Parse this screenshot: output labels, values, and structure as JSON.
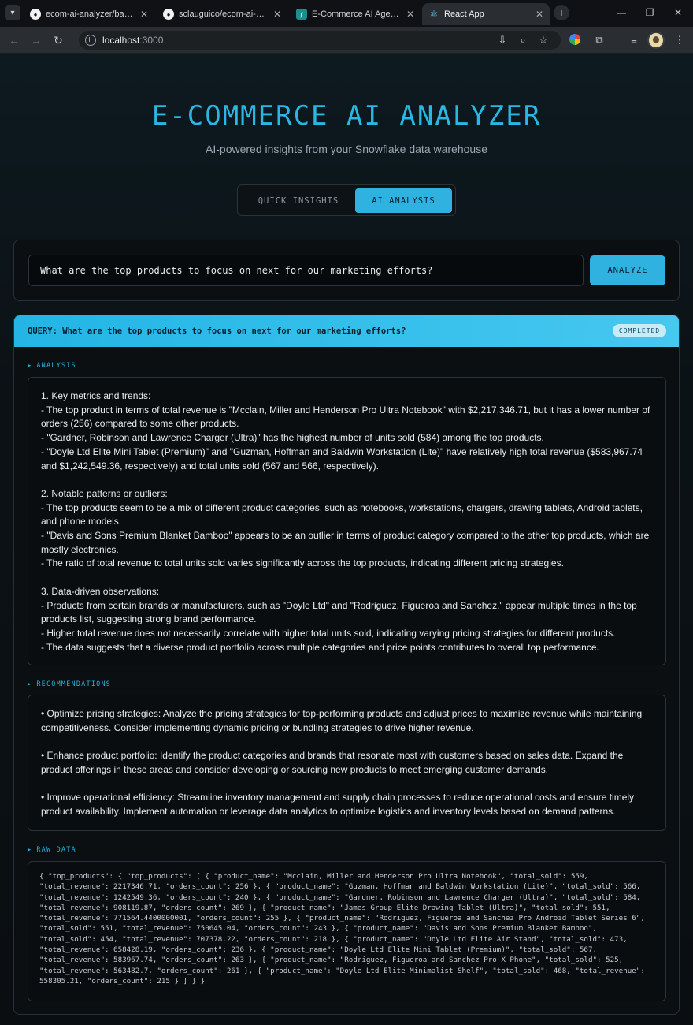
{
  "browser": {
    "tabs": [
      {
        "title": "ecom-ai-analyzer/backend",
        "icon": "github-icon"
      },
      {
        "title": "sclauguico/ecom-ai-analy",
        "icon": "github-icon"
      },
      {
        "title": "E-Commerce AI Agents A",
        "icon": "app-icon"
      },
      {
        "title": "React App",
        "icon": "react-icon",
        "active": true
      }
    ],
    "address": {
      "host": "localhost",
      "port": ":3000"
    }
  },
  "hero": {
    "title": "E-COMMERCE AI ANALYZER",
    "subtitle": "AI-powered insights from your Snowflake data warehouse"
  },
  "modes": {
    "quick_label": "QUICK INSIGHTS",
    "ai_label": "AI ANALYSIS",
    "active": "ai"
  },
  "query": {
    "value": "What are the top products to focus on next for our marketing efforts?",
    "analyze_label": "ANALYZE"
  },
  "result": {
    "header_text": "QUERY: What are the top products to focus on next for our marketing efforts?",
    "status": "COMPLETED",
    "analysis_label": "ANALYSIS",
    "analysis": {
      "s1_title": "1. Key metrics and trends:",
      "s1_l1": "- The top product in terms of total revenue is \"Mcclain, Miller and Henderson Pro Ultra Notebook\" with $2,217,346.71, but it has a lower number of orders (256) compared to some other products.",
      "s1_l2": "- \"Gardner, Robinson and Lawrence Charger (Ultra)\" has the highest number of units sold (584) among the top products.",
      "s1_l3": "- \"Doyle Ltd Elite Mini Tablet (Premium)\" and \"Guzman, Hoffman and Baldwin Workstation (Lite)\" have relatively high total revenue ($583,967.74 and $1,242,549.36, respectively) and total units sold (567 and 566, respectively).",
      "s2_title": "2. Notable patterns or outliers:",
      "s2_l1": "- The top products seem to be a mix of different product categories, such as notebooks, workstations, chargers, drawing tablets, Android tablets, and phone models.",
      "s2_l2": "- \"Davis and Sons Premium Blanket Bamboo\" appears to be an outlier in terms of product category compared to the other top products, which are mostly electronics.",
      "s2_l3": "- The ratio of total revenue to total units sold varies significantly across the top products, indicating different pricing strategies.",
      "s3_title": "3. Data-driven observations:",
      "s3_l1": "- Products from certain brands or manufacturers, such as \"Doyle Ltd\" and \"Rodriguez, Figueroa and Sanchez,\" appear multiple times in the top products list, suggesting strong brand performance.",
      "s3_l2": "- Higher total revenue does not necessarily correlate with higher total units sold, indicating varying pricing strategies for different products.",
      "s3_l3": "- The data suggests that a diverse product portfolio across multiple categories and price points contributes to overall top performance."
    },
    "recommendations_label": "RECOMMENDATIONS",
    "recommendations": {
      "r1": "• Optimize pricing strategies: Analyze the pricing strategies for top-performing products and adjust prices to maximize revenue while maintaining competitiveness. Consider implementing dynamic pricing or bundling strategies to drive higher revenue.",
      "r2": "• Enhance product portfolio: Identify the product categories and brands that resonate most with customers based on sales data. Expand the product offerings in these areas and consider developing or sourcing new products to meet emerging customer demands.",
      "r3": "• Improve operational efficiency: Streamline inventory management and supply chain processes to reduce operational costs and ensure timely product availability. Implement automation or leverage data analytics to optimize logistics and inventory levels based on demand patterns."
    },
    "raw_label": "RAW DATA",
    "raw_text": "{ \"top_products\": { \"top_products\": [ { \"product_name\": \"Mcclain, Miller and Henderson Pro Ultra Notebook\", \"total_sold\": 559, \"total_revenue\": 2217346.71, \"orders_count\": 256 }, { \"product_name\": \"Guzman, Hoffman and Baldwin Workstation (Lite)\", \"total_sold\": 566, \"total_revenue\": 1242549.36, \"orders_count\": 240 }, { \"product_name\": \"Gardner, Robinson and Lawrence Charger (Ultra)\", \"total_sold\": 584, \"total_revenue\": 908119.87, \"orders_count\": 269 }, { \"product_name\": \"James Group Elite Drawing Tablet (Ultra)\", \"total_sold\": 551, \"total_revenue\": 771564.4400000001, \"orders_count\": 255 }, { \"product_name\": \"Rodriguez, Figueroa and Sanchez Pro Android Tablet Series 6\", \"total_sold\": 551, \"total_revenue\": 750645.04, \"orders_count\": 243 }, { \"product_name\": \"Davis and Sons Premium Blanket Bamboo\", \"total_sold\": 454, \"total_revenue\": 707378.22, \"orders_count\": 218 }, { \"product_name\": \"Doyle Ltd Elite Air Stand\", \"total_sold\": 473, \"total_revenue\": 658428.19, \"orders_count\": 236 }, { \"product_name\": \"Doyle Ltd Elite Mini Tablet (Premium)\", \"total_sold\": 567, \"total_revenue\": 583967.74, \"orders_count\": 263 }, { \"product_name\": \"Rodriguez, Figueroa and Sanchez Pro X Phone\", \"total_sold\": 525, \"total_revenue\": 563482.7, \"orders_count\": 261 }, { \"product_name\": \"Doyle Ltd Elite Minimalist Shelf\", \"total_sold\": 468, \"total_revenue\": 558305.21, \"orders_count\": 215 } ] } }"
  },
  "colors": {
    "accent": "#2fb2e0",
    "title": "#2ab7e4",
    "background": "#0b1014"
  }
}
